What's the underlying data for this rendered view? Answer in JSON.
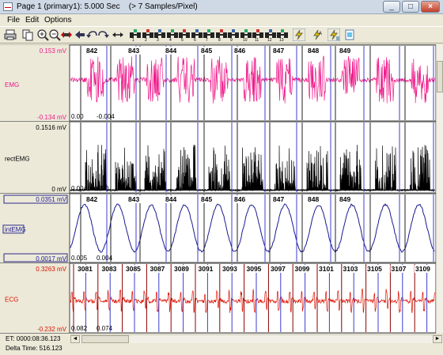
{
  "window": {
    "title": "Page 1 (primary1): 5.000 Sec",
    "rate": "(> 7 Samples/Pixel)",
    "controls": {
      "minimize": "_",
      "maximize": "□",
      "close": "×"
    }
  },
  "menu": {
    "file": "File",
    "edit": "Edit",
    "options": "Options"
  },
  "toolbar": {
    "icons": [
      "zoom-in-icon",
      "zoom-out-icon",
      "zoom-fit-icon",
      "move-left-icon",
      "undo-icon",
      "redo-icon",
      "expand-horizontal-icon",
      "marker-1-icon",
      "marker-2-icon",
      "marker-3-icon",
      "marker-4-icon",
      "marker-5-icon",
      "marker-6-icon",
      "marker-7-icon",
      "marker-8-icon",
      "marker-9-icon",
      "marker-10-icon",
      "marker-11-icon",
      "marker-12-icon",
      "marker-13-icon",
      "lightning-icon",
      "lightning-auto-icon",
      "lightning-framed-icon",
      "document-icon"
    ]
  },
  "colors": {
    "emg": "#ee1a8a",
    "rect": "#000000",
    "int": "#1a1a90",
    "ecg": "#dd1100",
    "marker_blue": "#3c3cd0",
    "marker_dark": "#202020",
    "marker_ecg": "#8a0000"
  },
  "channels": [
    {
      "id": "emg",
      "label": "EMG",
      "max": "0.153 mV",
      "min": "-0.134 mV",
      "max_boxed": false,
      "color": "#ee1a8a",
      "start_values": [
        "0.00",
        "-0.004"
      ],
      "beat_labels": [
        "842",
        "843",
        "844",
        "845",
        "846",
        "847",
        "848",
        "849"
      ]
    },
    {
      "id": "rect",
      "label": "rectEMG",
      "max": "0.1516 mV",
      "min": "0 mV",
      "max_boxed": false,
      "color": "#000000",
      "start_values": [
        "0.004",
        "0.00"
      ],
      "beat_labels": []
    },
    {
      "id": "int",
      "label": "intEMG",
      "max": "0.0351 mV",
      "min": "0.0017 mV",
      "max_boxed": true,
      "color": "#1a1a90",
      "start_values": [
        "0.005",
        "0.004"
      ],
      "beat_labels": [
        "842",
        "843",
        "844",
        "845",
        "846",
        "847",
        "848",
        "849"
      ]
    },
    {
      "id": "ecg",
      "label": "ECG",
      "max": "0.3263 mV",
      "min": "-0.232 mV",
      "max_boxed": false,
      "color": "#dd1100",
      "start_values": [
        "0.082",
        "0.074"
      ],
      "beat_labels": [
        "3081",
        "3083",
        "3085",
        "3087",
        "3089",
        "3091",
        "3093",
        "3095",
        "3097",
        "3099",
        "3101",
        "3103",
        "3105",
        "3107",
        "3109"
      ]
    }
  ],
  "status": {
    "et": "ET: 0000:08:36.123",
    "delta": "Delta Time:  516.123"
  },
  "hscroll": {
    "left": "◄",
    "right": "►"
  }
}
